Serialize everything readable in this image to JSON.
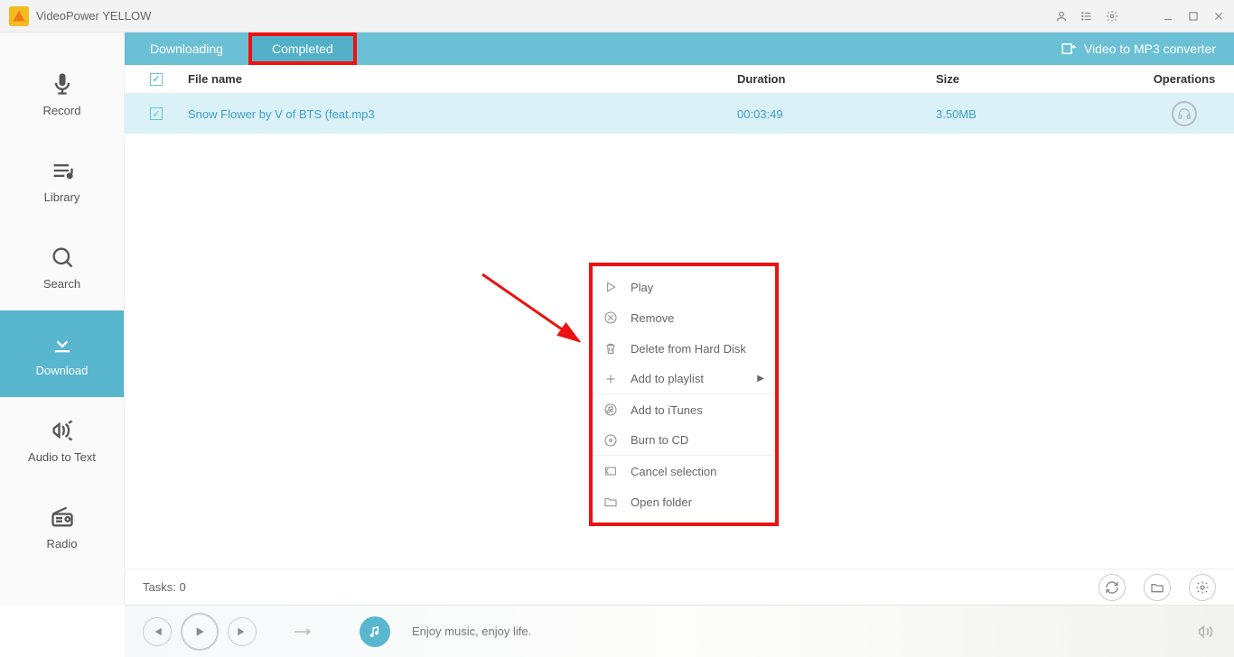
{
  "app": {
    "title": "VideoPower YELLOW"
  },
  "sidebar": {
    "items": [
      {
        "label": "Record"
      },
      {
        "label": "Library"
      },
      {
        "label": "Search"
      },
      {
        "label": "Download"
      },
      {
        "label": "Audio to Text"
      },
      {
        "label": "Radio"
      }
    ]
  },
  "tabs": {
    "downloading": "Downloading",
    "completed": "Completed",
    "converter": "Video to MP3 converter"
  },
  "table": {
    "headers": {
      "file": "File name",
      "duration": "Duration",
      "size": "Size",
      "ops": "Operations"
    },
    "rows": [
      {
        "name": "Snow Flower by V of BTS (feat.mp3",
        "duration": "00:03:49",
        "size": "3.50MB"
      }
    ]
  },
  "context_menu": {
    "items": [
      {
        "label": "Play"
      },
      {
        "label": "Remove"
      },
      {
        "label": "Delete from Hard Disk"
      },
      {
        "label": "Add to playlist",
        "submenu": true
      },
      {
        "label": "Add to iTunes"
      },
      {
        "label": "Burn to CD"
      },
      {
        "label": "Cancel selection"
      },
      {
        "label": "Open folder"
      }
    ]
  },
  "footer": {
    "tasks": "Tasks: 0"
  },
  "player": {
    "text": "Enjoy music, enjoy life."
  }
}
